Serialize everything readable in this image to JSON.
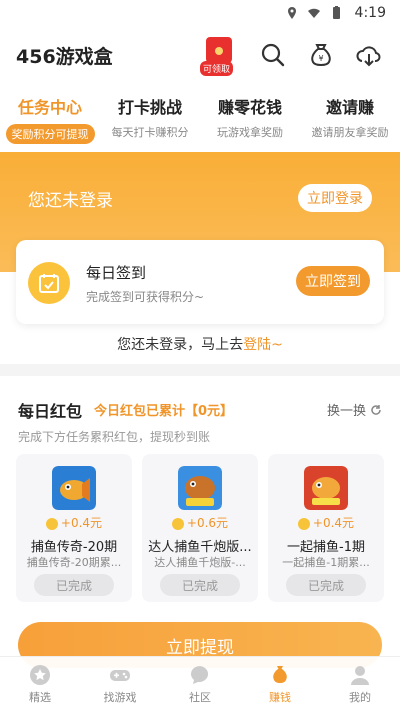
{
  "status_bar": {
    "time": "4:19"
  },
  "app": {
    "title": "456游戏盒",
    "redpack_tag": "可领取"
  },
  "tabs": [
    {
      "title": "任务中心",
      "sub": "奖励积分可提现",
      "active": true
    },
    {
      "title": "打卡挑战",
      "sub": "每天打卡赚积分",
      "active": false
    },
    {
      "title": "赚零花钱",
      "sub": "玩游戏拿奖励",
      "active": false
    },
    {
      "title": "邀请赚",
      "sub": "邀请朋友拿奖励",
      "active": false
    }
  ],
  "banner": {
    "text": "您还未登录",
    "login_label": "立即登录"
  },
  "checkin": {
    "title": "每日签到",
    "subtitle": "完成签到可获得积分~",
    "button": "立即签到"
  },
  "notice": {
    "text": "您还未登录，马上去",
    "link": "登陆~"
  },
  "daily": {
    "title": "每日红包",
    "total": "今日红包已累计【0元】",
    "refresh": "换一换",
    "desc": "完成下方任务累积红包，提现秒到账",
    "items": [
      {
        "reward": "+0.4元",
        "name": "捕鱼传奇-20期",
        "desc": "捕鱼传奇-20期累...",
        "status": "已完成"
      },
      {
        "reward": "+0.6元",
        "name": "达人捕鱼千炮版...",
        "desc": "达人捕鱼千炮版-...",
        "status": "已完成"
      },
      {
        "reward": "+0.4元",
        "name": "一起捕鱼-1期",
        "desc": "一起捕鱼-1期累...",
        "status": "已完成"
      }
    ],
    "withdraw_label": "立即提现"
  },
  "bottom_nav": [
    {
      "label": "精选",
      "icon": "star-icon"
    },
    {
      "label": "找游戏",
      "icon": "gamepad-icon"
    },
    {
      "label": "社区",
      "icon": "chat-icon"
    },
    {
      "label": "赚钱",
      "icon": "money-bag-icon",
      "active": true
    },
    {
      "label": "我的",
      "icon": "user-icon"
    }
  ],
  "colors": {
    "accent": "#f39a2e",
    "banner": "#f9ae37",
    "redpack": "#e8312f"
  }
}
